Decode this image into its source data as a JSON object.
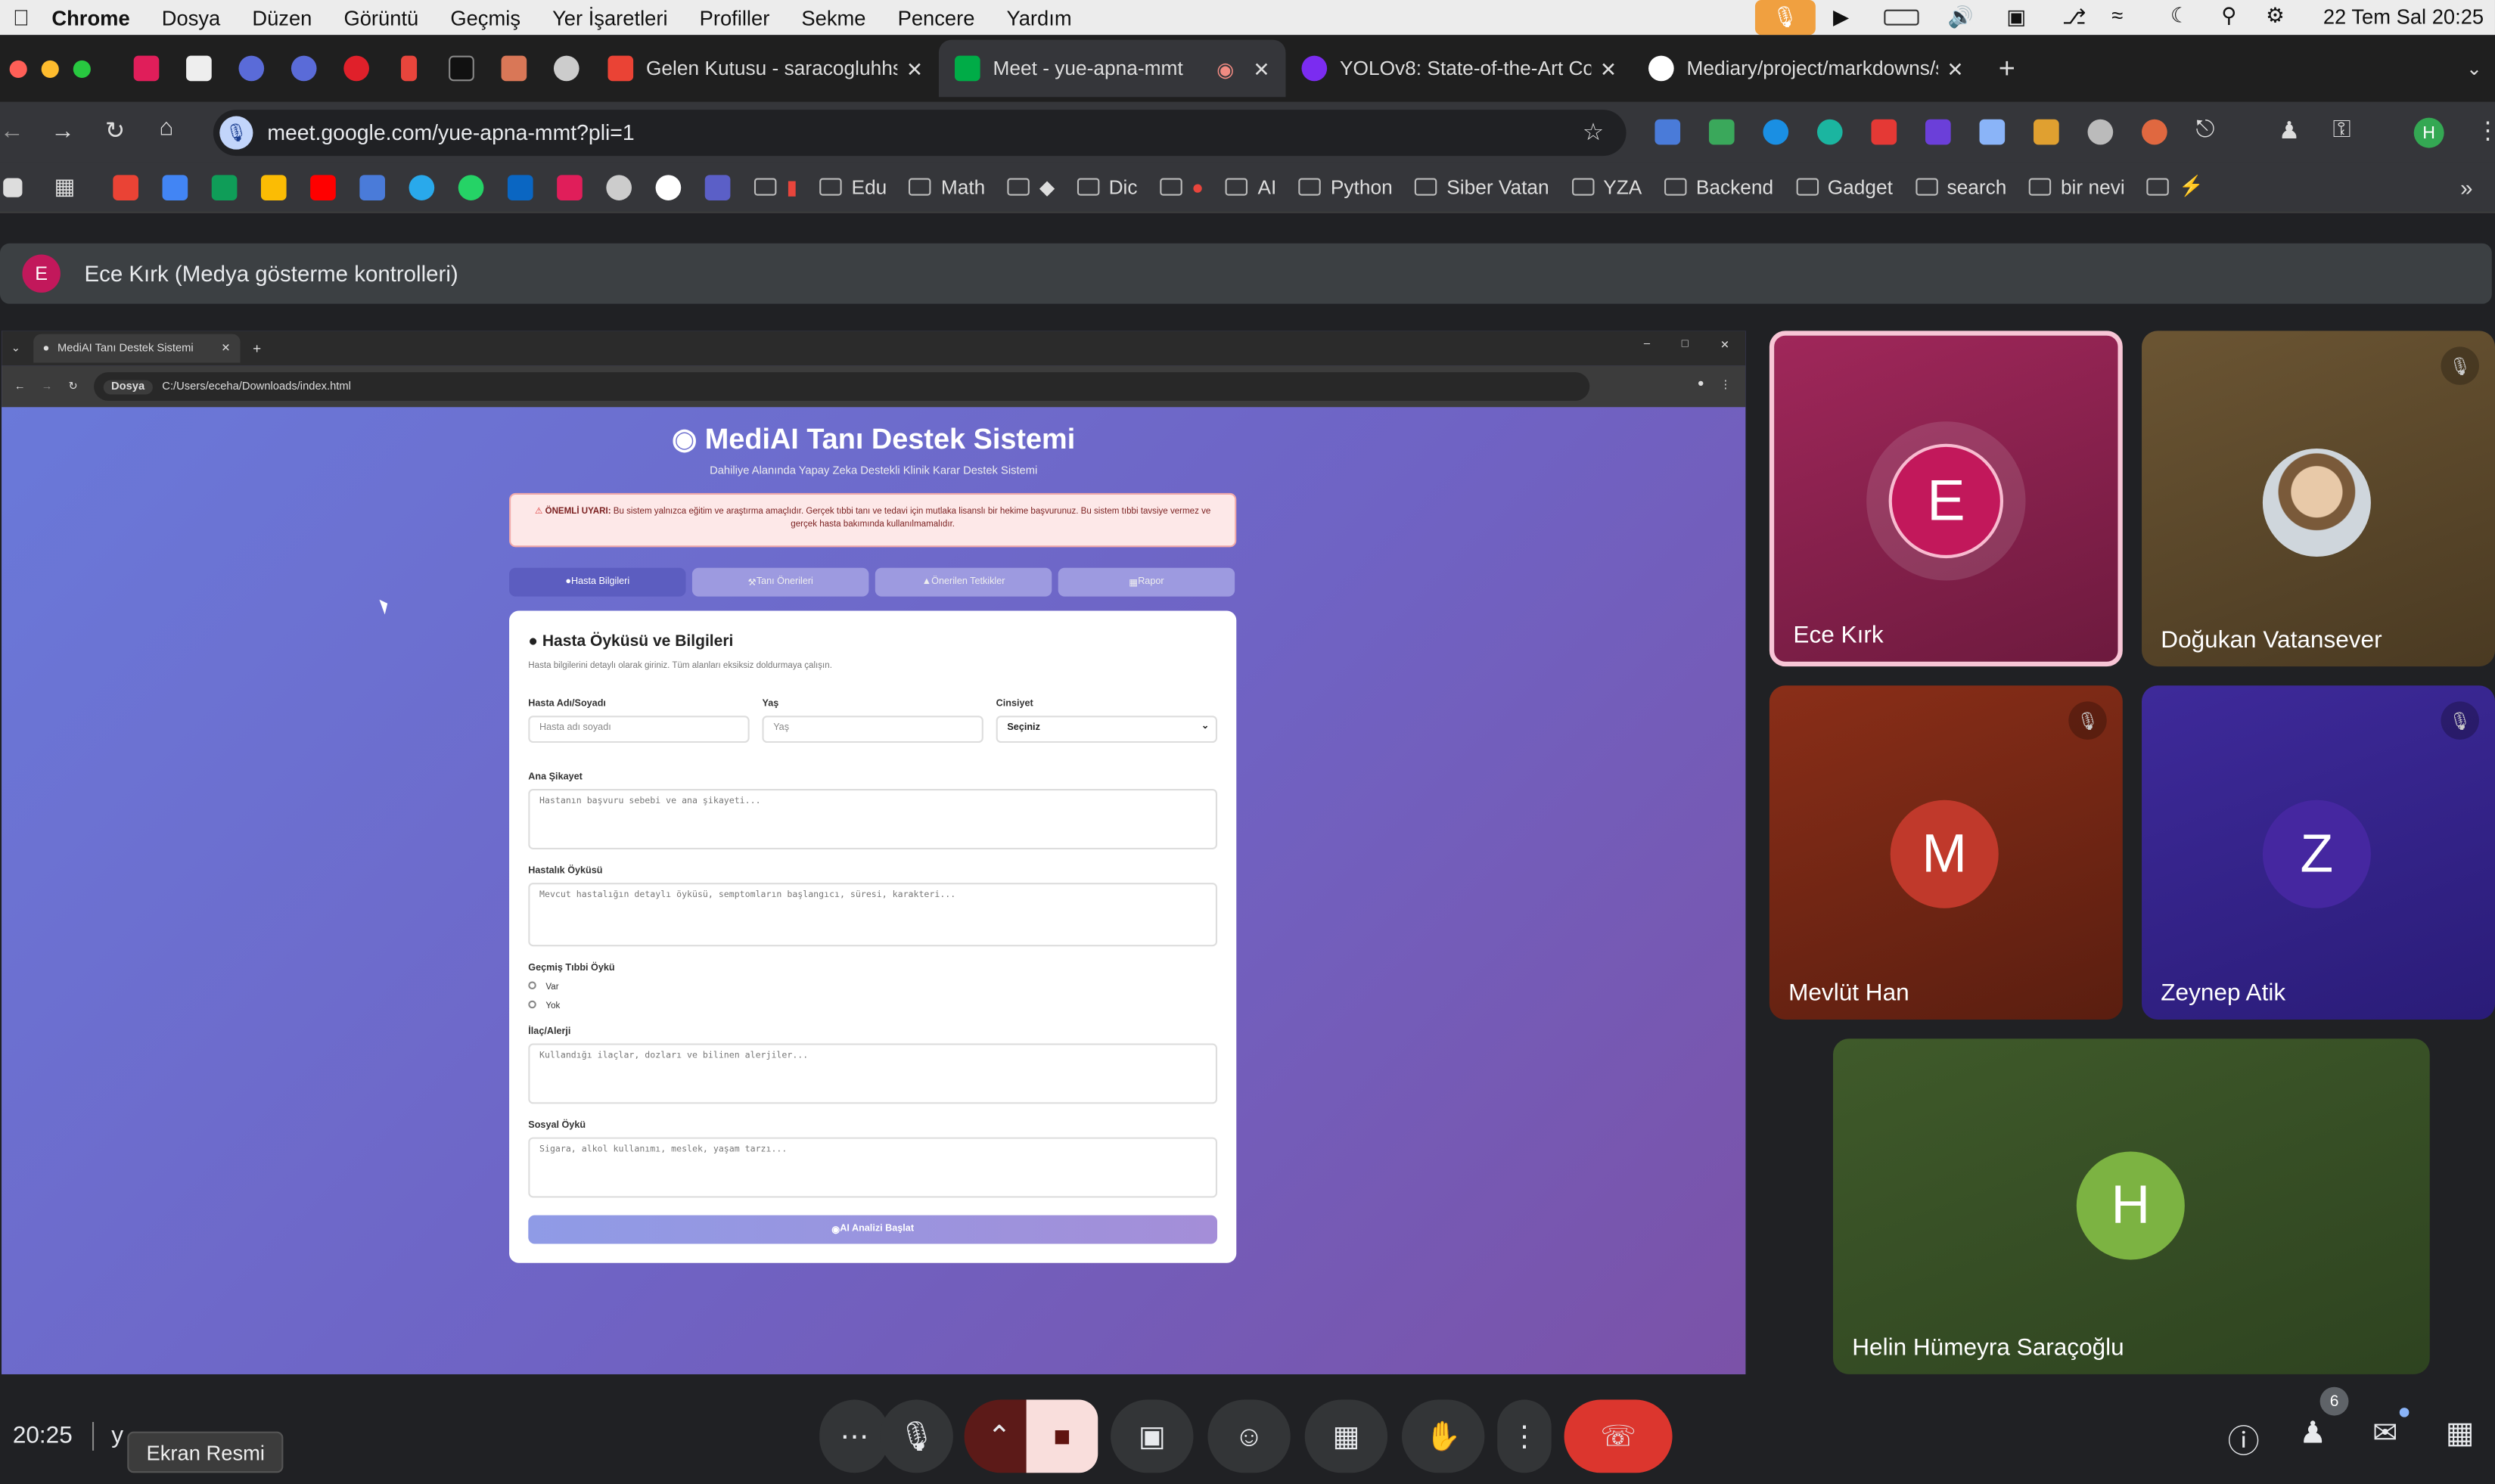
{
  "menubar": {
    "app": "Chrome",
    "items": [
      "Dosya",
      "Düzen",
      "Görüntü",
      "Geçmiş",
      "Yer İşaretleri",
      "Profiller",
      "Sekme",
      "Pencere",
      "Yardım"
    ],
    "datetime": "22 Tem Sal  20:25"
  },
  "tabs": {
    "gmail": "Gelen Kutusu - saracogluhhs",
    "meet": "Meet - yue-apna-mmt",
    "yolo": "YOLOv8: State-of-the-Art Co",
    "github": "Mediary/project/markdowns/s"
  },
  "address": {
    "url": "meet.google.com/yue-apna-mmt?pli=1"
  },
  "bookmarks": [
    "Edu",
    "Math",
    "Dic",
    "AI",
    "Python",
    "Siber Vatan",
    "YZA",
    "Backend",
    "Gadget",
    "search",
    "bir nevi"
  ],
  "presenter": {
    "initial": "E",
    "label": "Ece Kırk (Medya gösterme kontrolleri)"
  },
  "shared": {
    "tab_title": "MediAI Tanı Destek Sistemi",
    "chip": "Dosya",
    "path": "C:/Users/eceha/Downloads/index.html",
    "title": "MediAI Tanı Destek Sistemi",
    "subtitle": "Dahiliye Alanında Yapay Zeka Destekli Klinik Karar Destek Sistemi",
    "warning_bold": "ÖNEMLİ UYARI:",
    "warning_text": "Bu sistem yalnızca eğitim ve araştırma amaçlıdır. Gerçek tıbbi tanı ve tedavi için mutlaka lisanslı bir hekime başvurunuz. Bu sistem tıbbi tavsiye vermez ve gerçek hasta bakımında kullanılmamalıdır.",
    "tabs": [
      "Hasta Bilgileri",
      "Tanı Önerileri",
      "Önerilen Tetkikler",
      "Rapor"
    ],
    "card_title": "Hasta Öyküsü ve Bilgileri",
    "card_hint": "Hasta bilgilerini detaylı olarak giriniz. Tüm alanları eksiksiz doldurmaya çalışın.",
    "name_label": "Hasta Adı/Soyadı",
    "name_ph": "Hasta adı soyadı",
    "age_label": "Yaş",
    "age_ph": "Yaş",
    "sex_label": "Cinsiyet",
    "sex_value": "Seçiniz",
    "complaint_label": "Ana Şikayet",
    "complaint_ph": "Hastanın başvuru sebebi ve ana şikayeti...",
    "history_label": "Hastalık Öyküsü",
    "history_ph": "Mevcut hastalığın detaylı öyküsü, semptomların başlangıcı, süresi, karakteri...",
    "past_label": "Geçmiş Tıbbi Öykü",
    "past_yes": "Var",
    "past_no": "Yok",
    "drug_label": "İlaç/Alerji",
    "drug_ph": "Kullandığı ilaçlar, dozları ve bilinen alerjiler...",
    "social_label": "Sosyal Öykü",
    "social_ph": "Sigara, alkol kullanımı, meslek, yaşam tarzı...",
    "button": "AI Analizi Başlat"
  },
  "participants": {
    "ece": {
      "name": "Ece Kırk",
      "initial": "E"
    },
    "dogukan": {
      "name": "Doğukan Vatansever"
    },
    "mevlut": {
      "name": "Mevlüt Han",
      "initial": "M"
    },
    "zeynep": {
      "name": "Zeynep Atik",
      "initial": "Z"
    },
    "helin": {
      "name": "Helin Hümeyra Saraçoğlu",
      "initial": "H"
    }
  },
  "bottom": {
    "time": "20:25",
    "meeting_partial": "y",
    "tooltip": "Ekran Resmi",
    "people_count": "6"
  },
  "colors": {
    "accent": "#8ab4f8",
    "end_call": "#ea4335",
    "camera_off": "#f9dedc"
  }
}
